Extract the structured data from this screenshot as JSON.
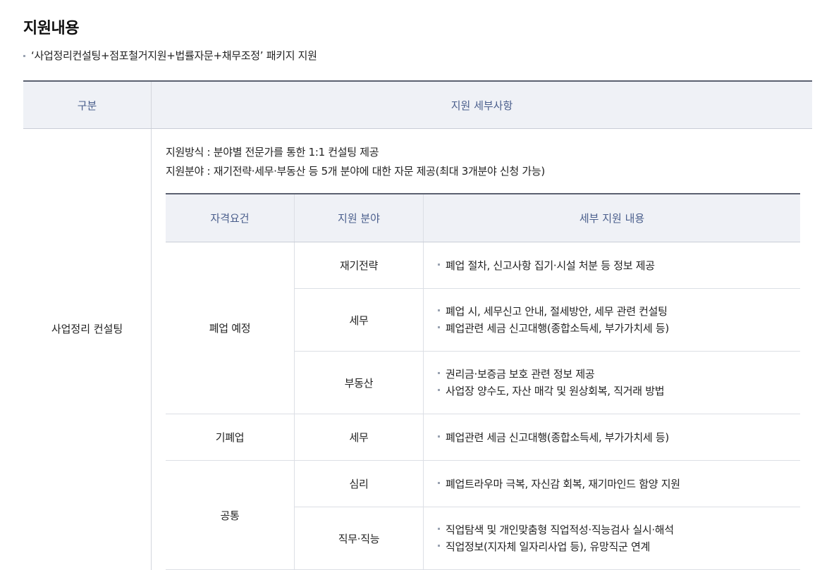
{
  "section": {
    "title": "지원내용",
    "subtitle": "‘사업정리컨설팅+점포철거지원+법률자문+채무조정’ 패키지 지원"
  },
  "table": {
    "headers": [
      "구분",
      "지원 세부사항"
    ],
    "category": "사업정리 컨설팅",
    "method_line": "지원방식 : 분야별 전문가를 통한 1:1 컨설팅 제공",
    "field_line": "지원분야 : 재기전략·세무·부동산 등 5개 분야에 대한 자문 제공(최대 3개분야 신청 가능)",
    "inner": {
      "headers": [
        "자격요건",
        "지원 분야",
        "세부 지원 내용"
      ],
      "groups": [
        {
          "requirement": "폐업 예정",
          "rows": [
            {
              "field": "재기전략",
              "details": [
                "폐업 절차, 신고사항 집기·시설 처분 등 정보 제공"
              ]
            },
            {
              "field": "세무",
              "details": [
                "폐업 시, 세무신고 안내, 절세방안, 세무 관련 컨설팅",
                "폐업관련 세금 신고대행(종합소득세, 부가가치세 등)"
              ]
            },
            {
              "field": "부동산",
              "details": [
                "권리금·보증금 보호 관련 정보 제공",
                "사업장 양수도, 자산 매각 및 원상회복, 직거래 방법"
              ]
            }
          ]
        },
        {
          "requirement": "기폐업",
          "rows": [
            {
              "field": "세무",
              "details": [
                "폐업관련 세금 신고대행(종합소득세, 부가가치세 등)"
              ]
            }
          ]
        },
        {
          "requirement": "공통",
          "rows": [
            {
              "field": "심리",
              "details": [
                "폐업트라우마 극복, 자신감 회복, 재기마인드 함양 지원"
              ]
            },
            {
              "field": "직무·직능",
              "details": [
                "직업탐색 및 개인맞춤형 직업적성·직능검사 실시·해석",
                "직업정보(지자체 일자리사업 등), 유망직군 연계"
              ]
            }
          ]
        }
      ]
    }
  }
}
